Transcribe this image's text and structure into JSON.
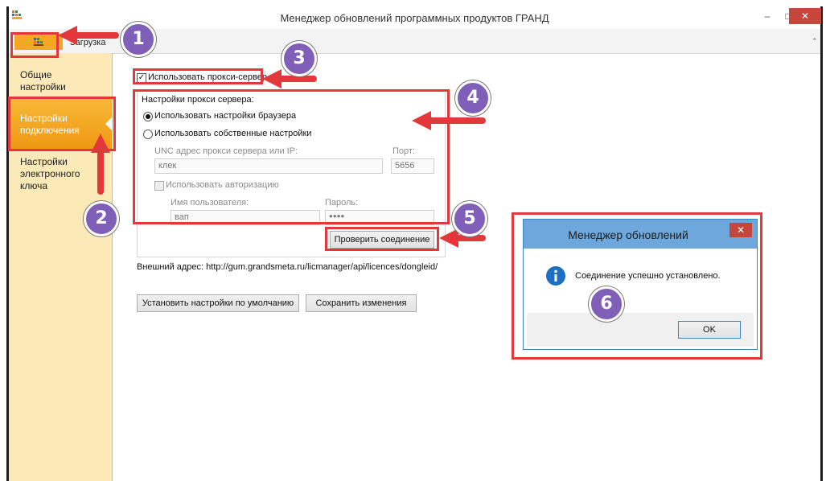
{
  "window": {
    "title": "Менеджер обновлений программных продуктов ГРАНД"
  },
  "ribbon": {
    "tab_download": "Загрузка"
  },
  "sidebar": {
    "items": [
      {
        "label_line1": "Общие",
        "label_line2": "настройки"
      },
      {
        "label_line1": "Настройки",
        "label_line2": "подключения"
      },
      {
        "label_line1": "Настройки",
        "label_line2": "электронного",
        "label_line3": "ключа"
      }
    ]
  },
  "proxy": {
    "use_proxy_label": "Использовать прокси-сервер",
    "use_proxy_checked": true,
    "group_label": "Настройки прокси сервера:",
    "radio_browser_label": "Использовать настройки браузера",
    "radio_custom_label": "Использовать собственные настройки",
    "selected": "browser",
    "address_label": "UNC адрес прокси сервера или IP:",
    "address_value": "клек",
    "port_label": "Порт:",
    "port_value": "5656",
    "auth_label": "Использовать авторизацию",
    "username_label": "Имя пользователя:",
    "username_value": "вап",
    "password_label": "Пароль:",
    "password_value": "●●●●",
    "check_button": "Проверить соединение"
  },
  "external_address": "Внешний адрес: http://gum.grandsmeta.ru/licmanager/api/licences/dongleid/",
  "buttons": {
    "defaults": "Установить настройки по умолчанию",
    "save": "Сохранить изменения"
  },
  "dialog": {
    "title": "Менеджер обновлений",
    "message": "Соединение успешно установлено.",
    "ok": "OK"
  },
  "badges": [
    "1",
    "2",
    "3",
    "4",
    "5",
    "6"
  ],
  "colors": {
    "accent_orange": "#f3a723",
    "annotation_red": "#e2383b",
    "badge_purple": "#7f5fb8",
    "dialog_header": "#6ea7dc"
  }
}
